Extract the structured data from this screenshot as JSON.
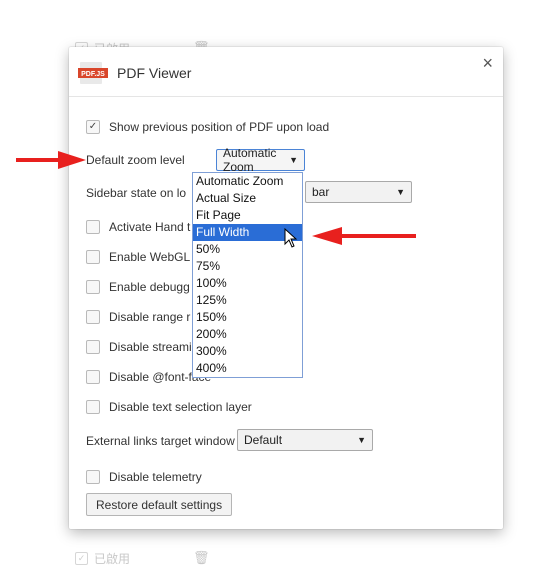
{
  "background": {
    "top_row": {
      "label": "已啟用",
      "checked": true
    },
    "bottom_row": {
      "label": "已啟用",
      "checked": true
    }
  },
  "dialog": {
    "logo_text": "PDF.JS",
    "title": "PDF Viewer",
    "close_glyph": "×"
  },
  "settings": {
    "show_previous_position": {
      "label": "Show previous position of PDF upon load",
      "checked": true
    },
    "default_zoom": {
      "label": "Default zoom level",
      "value": "Automatic Zoom"
    },
    "sidebar_state": {
      "label": "Sidebar state on lo",
      "value_visible": "bar"
    },
    "activate_hand": {
      "label": "Activate Hand t",
      "checked": false
    },
    "enable_webgl": {
      "label": "Enable WebGL",
      "checked": false
    },
    "enable_debugger": {
      "label": "Enable debugg",
      "checked": false
    },
    "disable_range": {
      "label": "Disable range r",
      "checked": false
    },
    "disable_streaming": {
      "label": "Disable streami",
      "checked": false
    },
    "disable_font_face": {
      "label": "Disable @font-face",
      "checked": false
    },
    "disable_text_selection": {
      "label": "Disable text selection layer",
      "checked": false
    },
    "external_links": {
      "label": "External links target window",
      "value": "Default"
    },
    "disable_telemetry": {
      "label": "Disable telemetry",
      "checked": false
    },
    "restore_button": "Restore default settings"
  },
  "zoom_dropdown": {
    "options": [
      "Automatic Zoom",
      "Actual Size",
      "Fit Page",
      "Full Width",
      "50%",
      "75%",
      "100%",
      "125%",
      "150%",
      "200%",
      "300%",
      "400%"
    ],
    "highlighted_index": 3
  },
  "colors": {
    "accent_highlight": "#2a6dd6",
    "annotation_arrow": "#e8201e",
    "logo_red": "#d9462b"
  }
}
